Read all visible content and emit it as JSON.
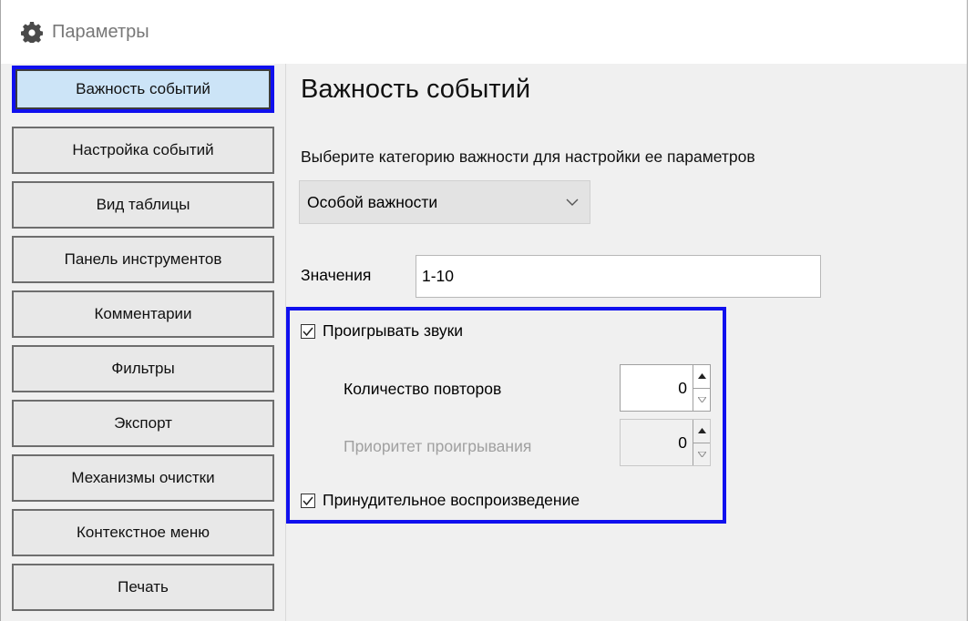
{
  "window": {
    "title": "Параметры",
    "icon": "gear-icon"
  },
  "sidebar": {
    "items": [
      {
        "label": "Важность событий",
        "active": true
      },
      {
        "label": "Настройка событий"
      },
      {
        "label": "Вид таблицы"
      },
      {
        "label": "Панель инструментов"
      },
      {
        "label": "Комментарии"
      },
      {
        "label": "Фильтры"
      },
      {
        "label": "Экспорт"
      },
      {
        "label": "Механизмы очистки"
      },
      {
        "label": "Контекстное меню"
      },
      {
        "label": "Печать"
      }
    ]
  },
  "main": {
    "title": "Важность событий",
    "category_prompt": "Выберите категорию важности для настройки ее параметров",
    "category_select": {
      "value": "Особой важности"
    },
    "values_label": "Значения",
    "values_input": "1-10",
    "play_sounds": {
      "label": "Проигрывать звуки",
      "checked": true
    },
    "repeat_count": {
      "label": "Количество повторов",
      "value": "0"
    },
    "play_priority": {
      "label": "Приоритет проигрывания",
      "value": "0",
      "disabled": true
    },
    "forced_playback": {
      "label": "Принудительное воспроизведение",
      "checked": true
    }
  },
  "colors": {
    "highlight_border": "#1010ee",
    "active_nav_bg": "#cce4f7",
    "panel_bg": "#f0f0f0"
  }
}
